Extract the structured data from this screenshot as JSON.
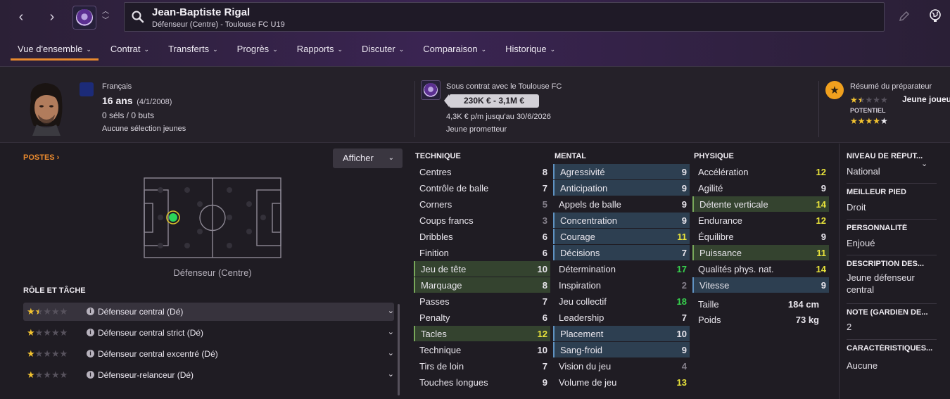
{
  "header": {
    "player_name": "Jean-Baptiste Rigal",
    "subtitle": "Défenseur (Centre) - Toulouse FC U19",
    "tabs": [
      {
        "label": "Vue d'ensemble",
        "active": true
      },
      {
        "label": "Contrat"
      },
      {
        "label": "Transferts"
      },
      {
        "label": "Progrès"
      },
      {
        "label": "Rapports"
      },
      {
        "label": "Discuter"
      },
      {
        "label": "Comparaison"
      },
      {
        "label": "Historique"
      }
    ],
    "icons": [
      "chevron-left-icon",
      "chevron-right-icon",
      "club-badge-icon",
      "up-down-icon",
      "search-icon",
      "edit-icon",
      "globe-icon"
    ]
  },
  "profile": {
    "nationality": "Français",
    "age": "16 ans",
    "dob": "(4/1/2008)",
    "caps": "0 séls / 0 buts",
    "youth_caps": "Aucune sélection jeunes",
    "contract_label": "Sous contrat avec le Toulouse FC",
    "value": "230K € - 3,1M €",
    "wage": "4,3K € p/m jusqu'au 30/6/2026",
    "status": "Jeune prometteur",
    "scout_title": "Résumé du préparateur",
    "scout_summary": "Jeune joueu",
    "potential_label": "POTENTIEL",
    "current_ability_stars": 1.5,
    "potential_stars": 4.5,
    "accent_star": "#f4c430"
  },
  "positions": {
    "postes_link": "POSTES",
    "display_button": "Afficher",
    "position_label": "Défenseur (Centre)",
    "role_heading": "RÔLE ET TÂCHE",
    "roles": [
      {
        "name": "Défenseur central (Dé)",
        "stars": 1.5,
        "selected": true
      },
      {
        "name": "Défenseur central strict (Dé)",
        "stars": 1
      },
      {
        "name": "Défenseur central excentré (Dé)",
        "stars": 1
      },
      {
        "name": "Défenseur-relanceur (Dé)",
        "stars": 1
      }
    ]
  },
  "attributes": {
    "technique": {
      "title": "TECHNIQUE",
      "rows": [
        {
          "name": "Centres",
          "value": "8"
        },
        {
          "name": "Contrôle de balle",
          "value": "7"
        },
        {
          "name": "Corners",
          "value": "5",
          "tone": "dim"
        },
        {
          "name": "Coups francs",
          "value": "3",
          "tone": "dim"
        },
        {
          "name": "Dribbles",
          "value": "6"
        },
        {
          "name": "Finition",
          "value": "6"
        },
        {
          "name": "Jeu de tête",
          "value": "10",
          "hl": "green"
        },
        {
          "name": "Marquage",
          "value": "8",
          "hl": "green"
        },
        {
          "name": "Passes",
          "value": "7"
        },
        {
          "name": "Penalty",
          "value": "6"
        },
        {
          "name": "Tacles",
          "value": "12",
          "hl": "green",
          "tone": "yellow"
        },
        {
          "name": "Technique",
          "value": "10"
        },
        {
          "name": "Tirs de loin",
          "value": "7"
        },
        {
          "name": "Touches longues",
          "value": "9"
        }
      ]
    },
    "mental": {
      "title": "MENTAL",
      "rows": [
        {
          "name": "Agressivité",
          "value": "9",
          "hl": "blue"
        },
        {
          "name": "Anticipation",
          "value": "9",
          "hl": "blue"
        },
        {
          "name": "Appels de balle",
          "value": "9"
        },
        {
          "name": "Concentration",
          "value": "9",
          "hl": "blue"
        },
        {
          "name": "Courage",
          "value": "11",
          "hl": "blue",
          "tone": "yellow"
        },
        {
          "name": "Décisions",
          "value": "7",
          "hl": "blue"
        },
        {
          "name": "Détermination",
          "value": "17",
          "tone": "green"
        },
        {
          "name": "Inspiration",
          "value": "2",
          "tone": "dim"
        },
        {
          "name": "Jeu collectif",
          "value": "18",
          "tone": "green"
        },
        {
          "name": "Leadership",
          "value": "7"
        },
        {
          "name": "Placement",
          "value": "10",
          "hl": "blue"
        },
        {
          "name": "Sang-froid",
          "value": "9",
          "hl": "blue"
        },
        {
          "name": "Vision du jeu",
          "value": "4",
          "tone": "dim"
        },
        {
          "name": "Volume de jeu",
          "value": "13",
          "tone": "yellow"
        }
      ]
    },
    "physique": {
      "title": "PHYSIQUE",
      "rows": [
        {
          "name": "Accélération",
          "value": "12",
          "tone": "yellow"
        },
        {
          "name": "Agilité",
          "value": "9"
        },
        {
          "name": "Détente verticale",
          "value": "14",
          "hl": "green",
          "tone": "yellow"
        },
        {
          "name": "Endurance",
          "value": "12",
          "tone": "yellow"
        },
        {
          "name": "Équilibre",
          "value": "9"
        },
        {
          "name": "Puissance",
          "value": "11",
          "hl": "green",
          "tone": "yellow"
        },
        {
          "name": "Qualités phys. nat.",
          "value": "14",
          "tone": "yellow"
        },
        {
          "name": "Vitesse",
          "value": "9",
          "hl": "blue"
        }
      ],
      "extras": [
        {
          "name": "Taille",
          "value": "184 cm"
        },
        {
          "name": "Poids",
          "value": "73 kg"
        }
      ]
    }
  },
  "side_info": [
    {
      "label": "NIVEAU DE RÉPUT...",
      "value": "National"
    },
    {
      "label": "MEILLEUR PIED",
      "value": "Droit"
    },
    {
      "label": "PERSONNALITÉ",
      "value": "Enjoué"
    },
    {
      "label": "DESCRIPTION DES...",
      "value": "Jeune défenseur central"
    },
    {
      "label": "NOTE (GARDIEN DE...",
      "value": "2"
    },
    {
      "label": "CARACTÉRISTIQUES...",
      "value": "Aucune"
    }
  ]
}
